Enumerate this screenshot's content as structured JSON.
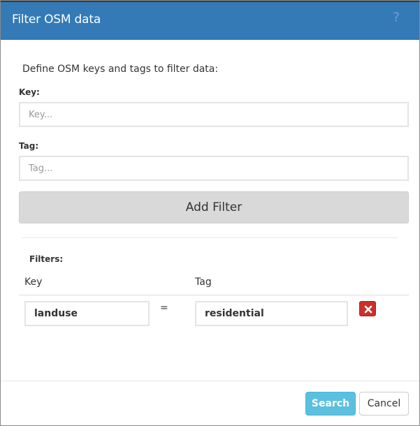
{
  "dialog": {
    "title": "Filter OSM data",
    "help_icon": "?",
    "intro": "Define OSM keys and tags to filter data:"
  },
  "form": {
    "key_label": "Key:",
    "key_placeholder": "Key...",
    "key_value": "",
    "tag_label": "Tag:",
    "tag_placeholder": "Tag...",
    "tag_value": "",
    "add_button": "Add Filter"
  },
  "filters": {
    "label": "Filters:",
    "columns": [
      "Key",
      "Tag"
    ],
    "rows": [
      {
        "key": "landuse",
        "operator": "=",
        "tag": "residential"
      }
    ]
  },
  "footer": {
    "search_button": "Search",
    "cancel_button": "Cancel"
  },
  "colors": {
    "header": "#337ab7",
    "search_button": "#5bc0de",
    "delete_button": "#c9302c"
  }
}
